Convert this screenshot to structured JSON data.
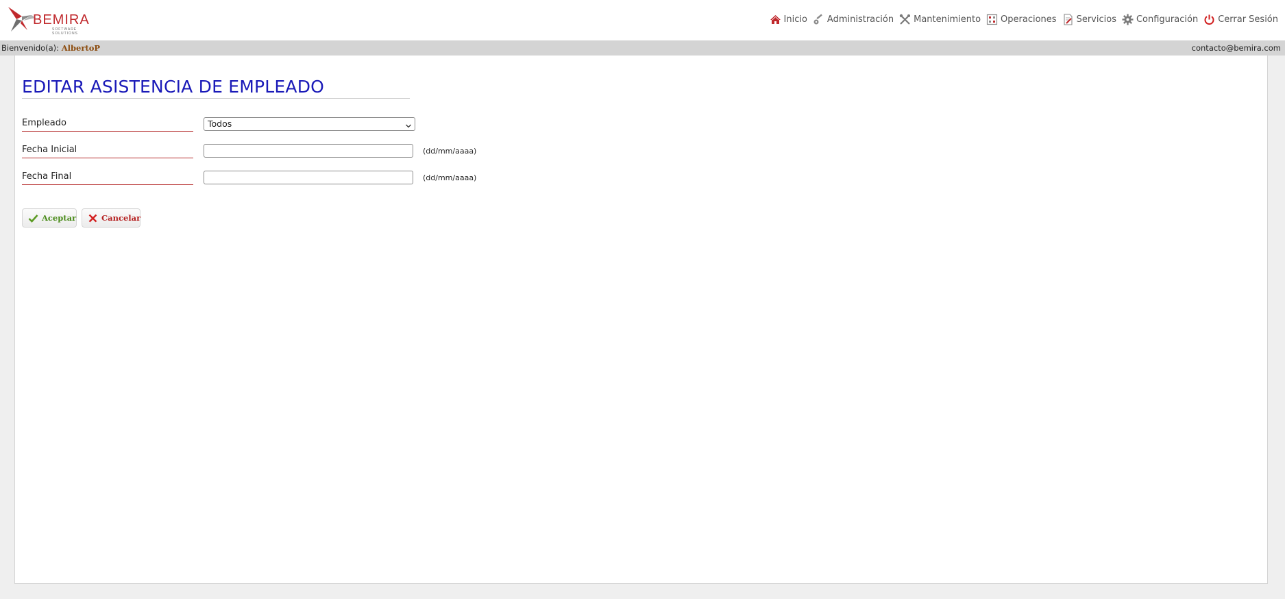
{
  "brand": {
    "name": "BEMIRA",
    "tagline": "SOFTWARE SOLUTIONS"
  },
  "nav": {
    "items": [
      {
        "label": "Inicio",
        "icon": "home-icon"
      },
      {
        "label": "Administración",
        "icon": "key-icon"
      },
      {
        "label": "Mantenimiento",
        "icon": "tools-icon"
      },
      {
        "label": "Operaciones",
        "icon": "grid-icon"
      },
      {
        "label": "Servicios",
        "icon": "document-edit-icon"
      },
      {
        "label": "Configuración",
        "icon": "gear-icon"
      },
      {
        "label": "Cerrar Sesión",
        "icon": "power-icon"
      }
    ]
  },
  "userbar": {
    "welcome_label": "Bienvenido(a):",
    "username": "AlbertoP",
    "contact": "contacto@bemira.com"
  },
  "page": {
    "title": "EDITAR ASISTENCIA DE EMPLEADO"
  },
  "form": {
    "empleado": {
      "label": "Empleado",
      "selected": "Todos"
    },
    "fecha_inicial": {
      "label": "Fecha Inicial",
      "value": "",
      "hint": "(dd/mm/aaaa)"
    },
    "fecha_final": {
      "label": "Fecha Final",
      "value": "",
      "hint": "(dd/mm/aaaa)"
    }
  },
  "buttons": {
    "accept": "Aceptar",
    "cancel": "Cancelar"
  },
  "colors": {
    "title": "#1a1ab8",
    "brand_red": "#c0282c",
    "label_underline": "#b52a2a",
    "accept_green": "#4a8b1a",
    "cancel_red": "#b52020"
  }
}
